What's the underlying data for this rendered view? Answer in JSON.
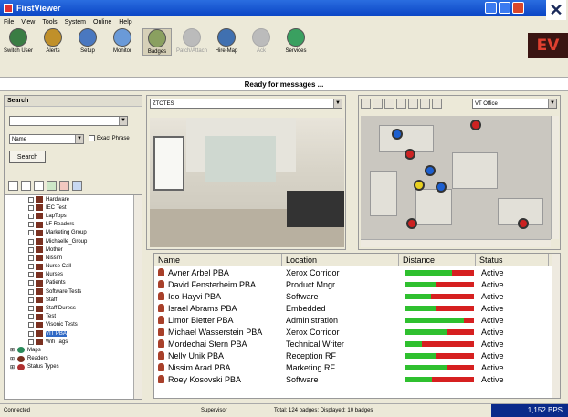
{
  "window": {
    "title": "FirstViewer"
  },
  "menu": [
    "File",
    "View",
    "Tools",
    "System",
    "Online",
    "Help"
  ],
  "toolbar": [
    {
      "label": "Switch User",
      "icon": "user-switch-icon",
      "color": "#3a7d44"
    },
    {
      "label": "Alerts",
      "icon": "alerts-icon",
      "color": "#c0902a"
    },
    {
      "label": "Setup",
      "icon": "setup-icon",
      "color": "#4a78c0"
    },
    {
      "label": "Monitor",
      "icon": "monitor-icon",
      "color": "#6a9ad8"
    },
    {
      "label": "Badges",
      "icon": "badges-icon",
      "color": "#8aa060",
      "active": true
    },
    {
      "label": "Patch/Attach",
      "icon": "patch-icon",
      "disabled": true
    },
    {
      "label": "Hire-Map",
      "icon": "map-icon",
      "color": "#4070b0"
    },
    {
      "label": "Ack",
      "icon": "ack-icon",
      "disabled": true
    },
    {
      "label": "Services",
      "icon": "services-icon",
      "color": "#3aa060"
    }
  ],
  "status_message": "Ready for messages ...",
  "search": {
    "header": "Search",
    "field_select": "Name",
    "exact_phrase_label": "Exact Phrase",
    "button_label": "Search"
  },
  "tree": {
    "groups": [
      "Hardware",
      "IEC Test",
      "LapTops",
      "LF Readers",
      "Marketing Group",
      "Michaelle_Group",
      "Mother",
      "Nissim",
      "Nurse Call",
      "Nurses",
      "Patients",
      "Software Tests",
      "Staff",
      "Staff Duress",
      "Test",
      "Visonic Tests",
      "VIT PBA",
      "Wifi Tags"
    ],
    "selected": "VIT PBA",
    "roots": [
      "Maps",
      "Readers",
      "Status Types"
    ]
  },
  "video": {
    "camera_select": "ZTOTES"
  },
  "map": {
    "floor_select": "VT Office"
  },
  "table": {
    "headers": [
      "Name",
      "Location",
      "Distance",
      "Status"
    ],
    "rows": [
      {
        "name": "Avner Arbel PBA",
        "location": "Xerox Corridor",
        "distance": 0.68,
        "status": "Active"
      },
      {
        "name": "David Fensterheim PBA",
        "location": "Product Mngr",
        "distance": 0.45,
        "status": "Active"
      },
      {
        "name": "Ido Hayvi PBA",
        "location": "Software",
        "distance": 0.38,
        "status": "Active"
      },
      {
        "name": "Israel Abrams PBA",
        "location": "Embedded",
        "distance": 0.45,
        "status": "Active"
      },
      {
        "name": "Limor Bletter PBA",
        "location": "Administration",
        "distance": 0.85,
        "status": "Active"
      },
      {
        "name": "Michael Wasserstein PBA",
        "location": "Xerox Corridor",
        "distance": 0.6,
        "status": "Active"
      },
      {
        "name": "Mordechai Stern PBA",
        "location": "Technical Writer",
        "distance": 0.25,
        "status": "Active"
      },
      {
        "name": "Nelly Unik PBA",
        "location": "Reception RF",
        "distance": 0.45,
        "status": "Active"
      },
      {
        "name": "Nissim Arad PBA",
        "location": "Marketing RF",
        "distance": 0.62,
        "status": "Active"
      },
      {
        "name": "Roey Kosovski PBA",
        "location": "Software",
        "distance": 0.4,
        "status": "Active"
      }
    ]
  },
  "statusbar": {
    "connection": "Connected",
    "user": "Supervisor",
    "counts": "Total: 124 badges; Displayed: 10 badges",
    "bps": "1,152 BPS"
  },
  "logo_text": "EV"
}
